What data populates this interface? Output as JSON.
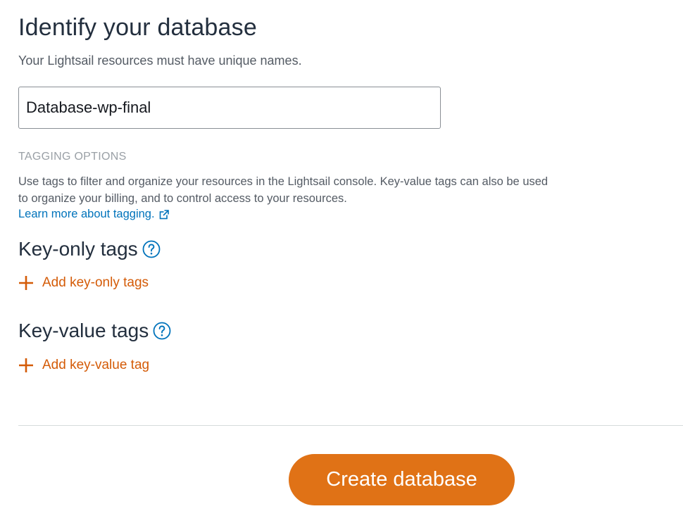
{
  "identify": {
    "title": "Identify your database",
    "subtitle": "Your Lightsail resources must have unique names.",
    "name_value": "Database-wp-final"
  },
  "tagging": {
    "section_label": "TAGGING OPTIONS",
    "description": "Use tags to filter and organize your resources in the Lightsail console. Key-value tags can also be used to organize your billing, and to control access to your resources.",
    "learn_more": "Learn more about tagging."
  },
  "key_only": {
    "heading": "Key-only tags",
    "add_label": "Add key-only tags"
  },
  "key_value": {
    "heading": "Key-value tags",
    "add_label": "Add key-value tag"
  },
  "actions": {
    "create_label": "Create database"
  },
  "colors": {
    "accent_orange": "#e07216",
    "link_blue": "#0073bb",
    "add_orange": "#d45b07"
  },
  "icons": {
    "help": "question-circle-icon",
    "external": "external-link-icon",
    "add": "plus-icon"
  }
}
